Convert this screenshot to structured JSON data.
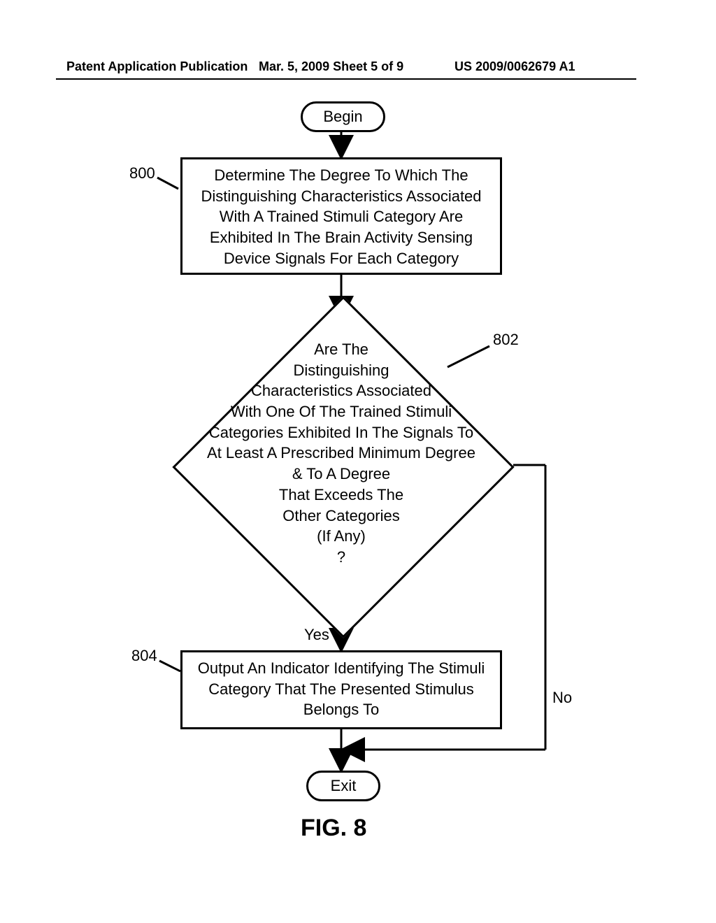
{
  "header": {
    "left": "Patent Application Publication",
    "center": "Mar. 5, 2009  Sheet 5 of 9",
    "right": "US 2009/0062679 A1"
  },
  "flow": {
    "begin": "Begin",
    "step800": "Determine The Degree To Which The Distinguishing Characteristics Associated With A Trained Stimuli Category Are Exhibited In The Brain Activity Sensing Device Signals For Each Category",
    "decision802": "Are The\nDistinguishing\nCharacteristics Associated\nWith One Of The Trained Stimuli\nCategories Exhibited In The Signals To\nAt Least A Prescribed Minimum Degree\n& To A Degree\nThat Exceeds The\nOther Categories\n(If Any)\n?",
    "step804": "Output An Indicator Identifying The Stimuli Category That The Presented Stimulus Belongs To",
    "exit": "Exit"
  },
  "refs": {
    "r800": "800",
    "r802": "802",
    "r804": "804"
  },
  "edges": {
    "yes": "Yes",
    "no": "No"
  },
  "figure": "FIG. 8",
  "chart_data": {
    "type": "flowchart",
    "nodes": [
      {
        "id": "begin",
        "type": "terminator",
        "label": "Begin"
      },
      {
        "id": "800",
        "type": "process",
        "label": "Determine The Degree To Which The Distinguishing Characteristics Associated With A Trained Stimuli Category Are Exhibited In The Brain Activity Sensing Device Signals For Each Category"
      },
      {
        "id": "802",
        "type": "decision",
        "label": "Are The Distinguishing Characteristics Associated With One Of The Trained Stimuli Categories Exhibited In The Signals To At Least A Prescribed Minimum Degree & To A Degree That Exceeds The Other Categories (If Any) ?"
      },
      {
        "id": "804",
        "type": "process",
        "label": "Output An Indicator Identifying The Stimuli Category That The Presented Stimulus Belongs To"
      },
      {
        "id": "exit",
        "type": "terminator",
        "label": "Exit"
      }
    ],
    "edges": [
      {
        "from": "begin",
        "to": "800"
      },
      {
        "from": "800",
        "to": "802"
      },
      {
        "from": "802",
        "to": "804",
        "label": "Yes"
      },
      {
        "from": "802",
        "to": "exit",
        "label": "No"
      },
      {
        "from": "804",
        "to": "exit"
      }
    ]
  }
}
